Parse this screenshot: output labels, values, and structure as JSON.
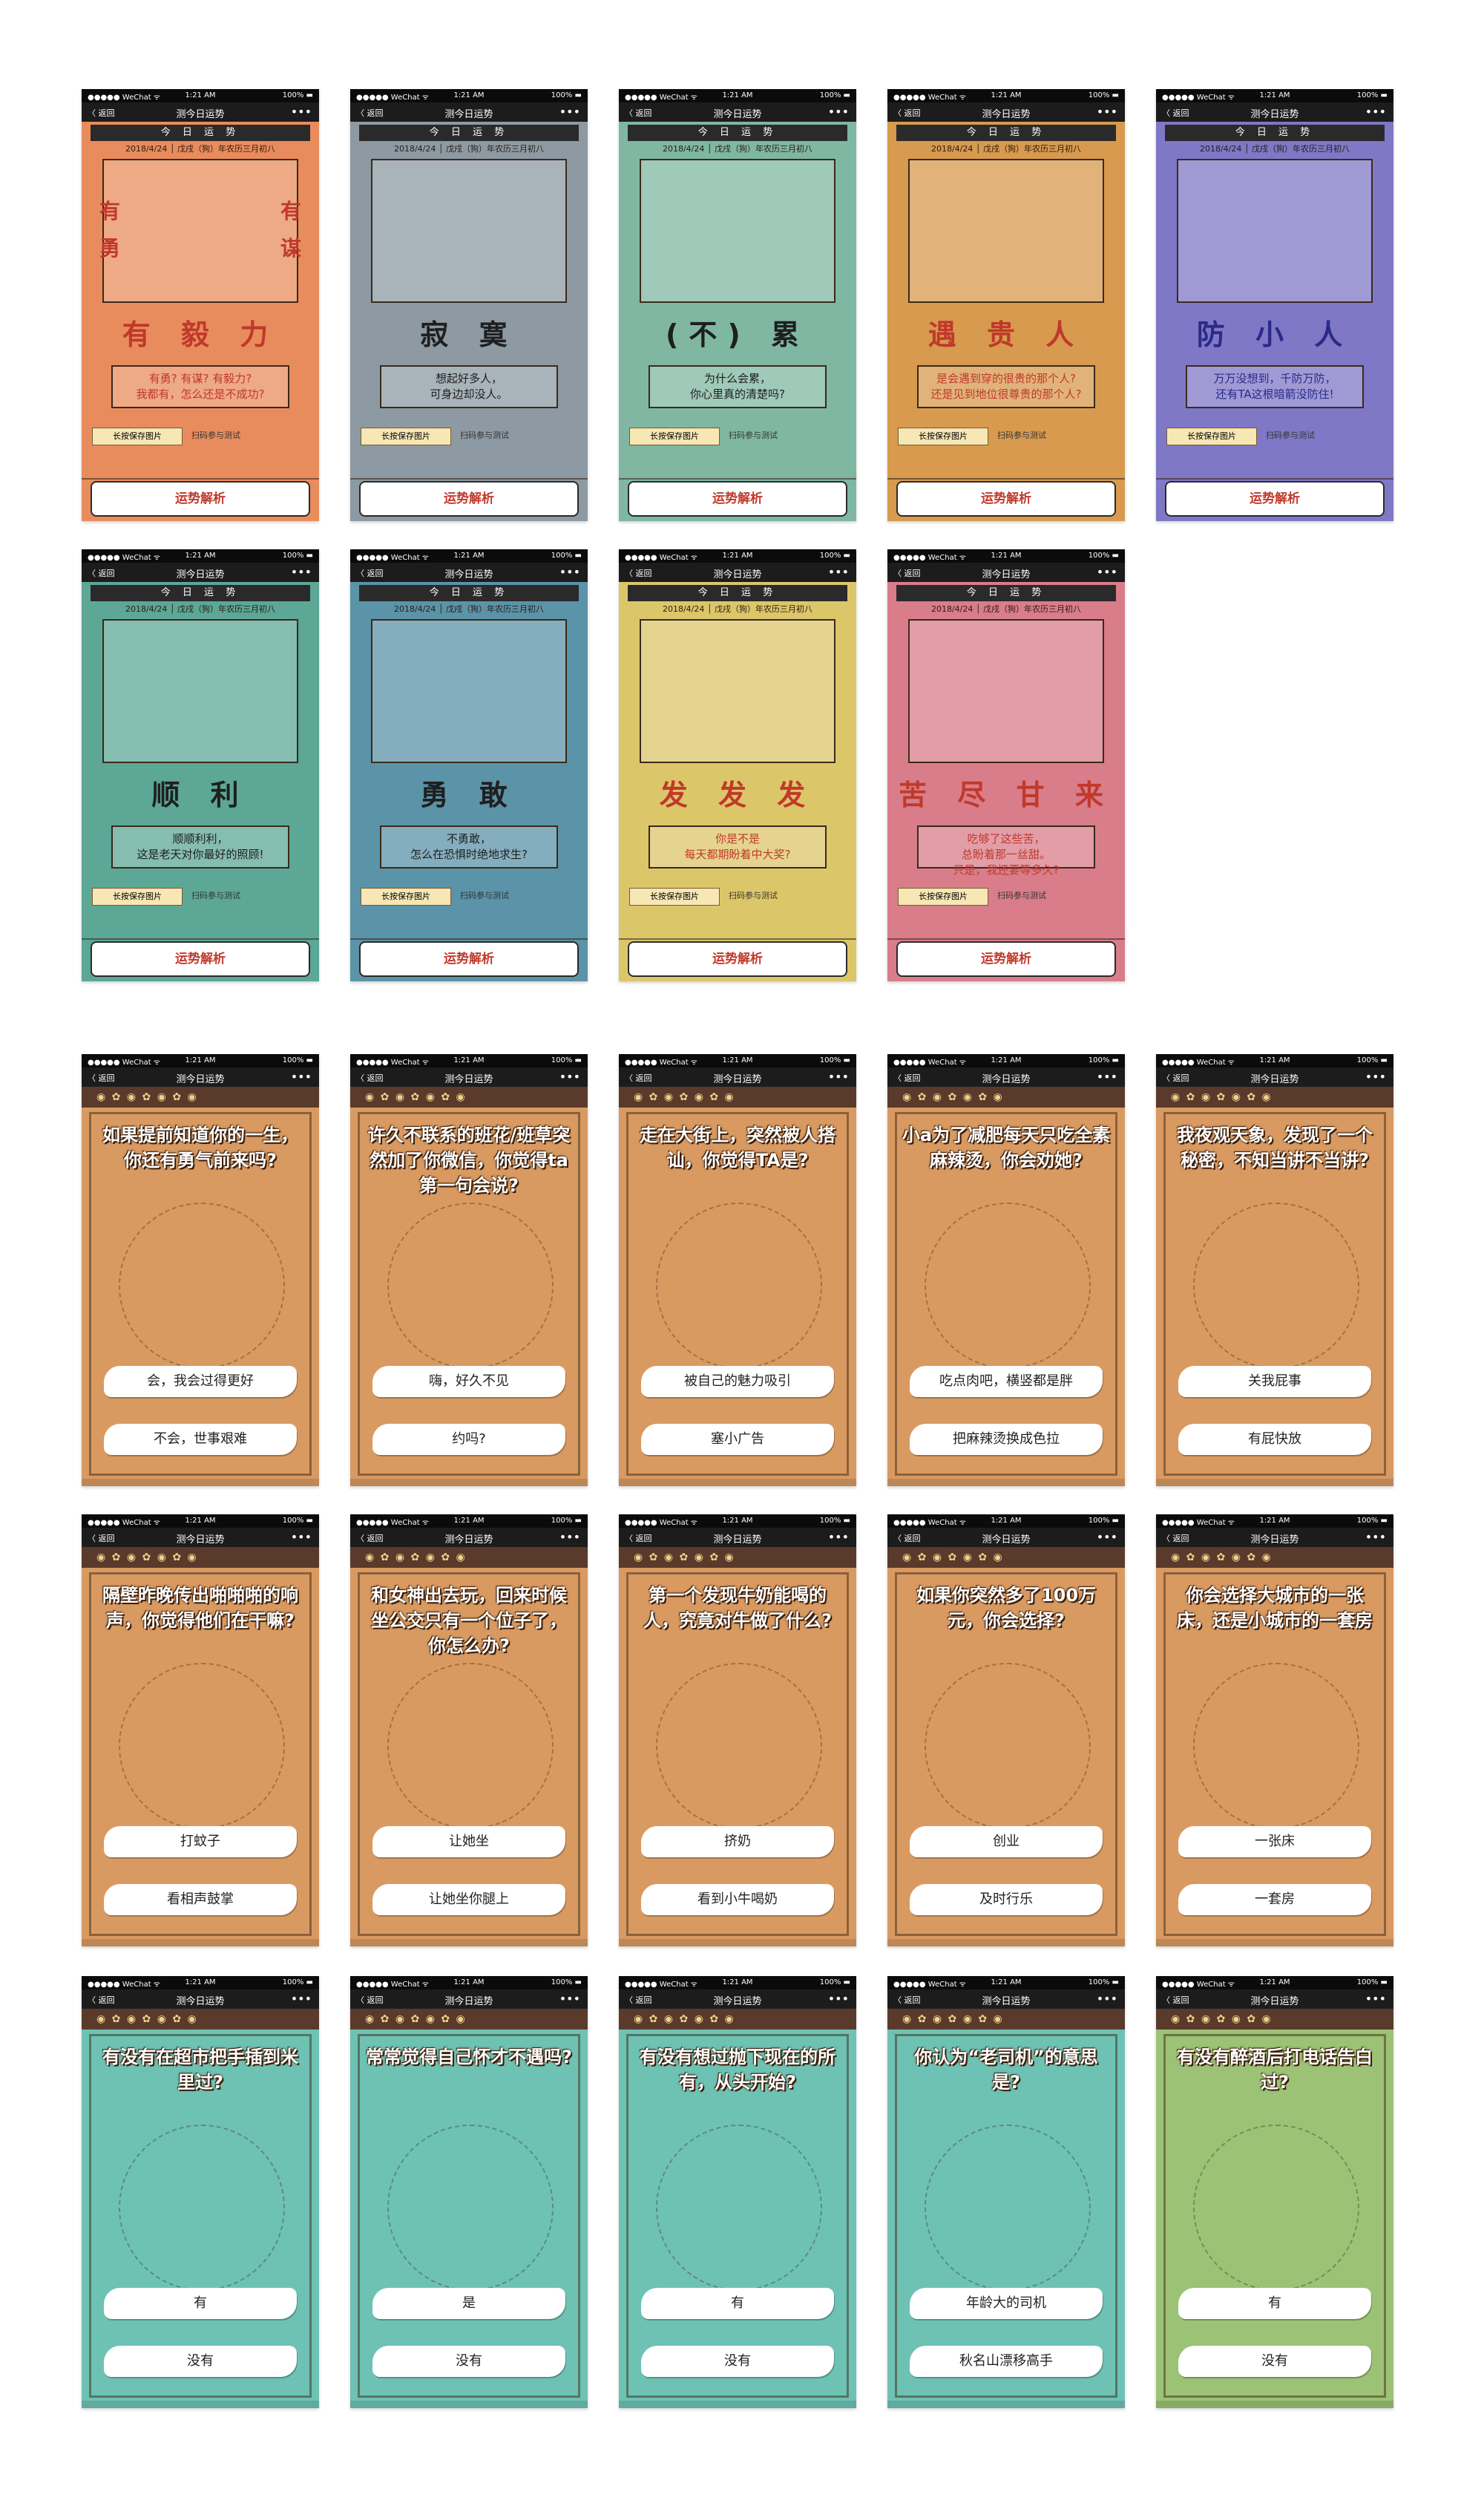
{
  "device": {
    "carrier": "●●●●● WeChat ᯤ",
    "time": "1:21 AM",
    "battery": "100% ▬"
  },
  "nav": {
    "back": "〈 返回",
    "title": "测今日运势",
    "more": "•••"
  },
  "fortune": {
    "header": "今 日 运 势",
    "date": "2018/4/24 │ 戊戌（狗）年农历三月初八",
    "save": "长按保存图片",
    "scan": "扫码参与测试",
    "button": "运势解析",
    "cards": [
      {
        "headline": "有 毅 力",
        "desc": "有勇? 有谋? 有毅力?\n我都有，怎么还是不成功?",
        "side_left": "有 勇",
        "side_right": "有 谋",
        "bg": "#e98c5d",
        "accent": "#c0392b"
      },
      {
        "headline": "寂 寞",
        "desc": "想起好多人，\n可身边却没人。",
        "bg": "#8d9aa3",
        "accent": "#1f1f1f"
      },
      {
        "headline": "(不) 累",
        "desc": "为什么会累，\n你心里真的清楚吗?",
        "bg": "#7fb7a2",
        "accent": "#1f1f1f"
      },
      {
        "headline": "遇 贵 人",
        "desc": "是会遇到穿的很贵的那个人?\n还是见到地位很尊贵的那个人?",
        "bg": "#d79a4e",
        "accent": "#c0392b"
      },
      {
        "headline": "防 小 人",
        "desc": "万万没想到，千防万防，\n还有TA这根暗箭没防住!",
        "bg": "#7f78c6",
        "accent": "#2a2a8a"
      },
      {
        "headline": "顺 利",
        "desc": "顺顺利利，\n这是老天对你最好的照顾!",
        "bg": "#5ca796",
        "accent": "#1f1f1f"
      },
      {
        "headline": "勇 敢",
        "desc": "不勇敢，\n怎么在恐惧时绝地求生?",
        "bg": "#5b93a8",
        "accent": "#1f1f1f"
      },
      {
        "headline": "发 发 发",
        "desc": "你是不是\n每天都期盼着中大奖?",
        "bg": "#dcc66a",
        "accent": "#c0392b"
      },
      {
        "headline": "苦 尽 甘 来",
        "desc": "吃够了这些苦，\n总盼着那一丝甜。\n只是，我还要等多久?",
        "bg": "#d97d8a",
        "accent": "#c0392b"
      }
    ]
  },
  "quiz": {
    "cards": [
      {
        "q": "如果提前知道你的一生，你还有勇气前来吗?",
        "a": "会，我会过得更好",
        "b": "不会，世事艰难",
        "bg": "#d99a62"
      },
      {
        "q": "许久不联系的班花/班草突然加了你微信，你觉得ta第一句会说?",
        "a": "嗨，好久不见",
        "b": "约吗?",
        "bg": "#d99a62"
      },
      {
        "q": "走在大街上，突然被人搭讪，你觉得TA是?",
        "a": "被自己的魅力吸引",
        "b": "塞小广告",
        "bg": "#d99a62"
      },
      {
        "q": "小a为了减肥每天只吃全素麻辣烫，你会劝她?",
        "a": "吃点肉吧，横竖都是胖",
        "b": "把麻辣烫换成色拉",
        "bg": "#d99a62"
      },
      {
        "q": "我夜观天象，发现了一个秘密，不知当讲不当讲?",
        "a": "关我屁事",
        "b": "有屁快放",
        "bg": "#d99a62"
      },
      {
        "q": "隔壁昨晚传出啪啪啪的响声，你觉得他们在干嘛?",
        "a": "打蚊子",
        "b": "看相声鼓掌",
        "bg": "#d99a62"
      },
      {
        "q": "和女神出去玩，回来时候坐公交只有一个位子了，你怎么办?",
        "a": "让她坐",
        "b": "让她坐你腿上",
        "bg": "#d99a62"
      },
      {
        "q": "第一个发现牛奶能喝的人，究竟对牛做了什么?",
        "a": "挤奶",
        "b": "看到小牛喝奶",
        "bg": "#d99a62"
      },
      {
        "q": "如果你突然多了100万元，你会选择?",
        "a": "创业",
        "b": "及时行乐",
        "bg": "#d99a62"
      },
      {
        "q": "你会选择大城市的一张床，还是小城市的一套房",
        "a": "一张床",
        "b": "一套房",
        "bg": "#d99a62"
      },
      {
        "q": "有没有在超市把手插到米里过?",
        "a": "有",
        "b": "没有",
        "bg": "#6ec2b4"
      },
      {
        "q": "常常觉得自己怀才不遇吗?",
        "a": "是",
        "b": "没有",
        "bg": "#6ec2b4"
      },
      {
        "q": "有没有想过抛下现在的所有，从头开始?",
        "a": "有",
        "b": "没有",
        "bg": "#6ec2b4"
      },
      {
        "q": "你认为“老司机”的意思是?",
        "a": "年龄大的司机",
        "b": "秋名山漂移高手",
        "bg": "#6ec2b4"
      },
      {
        "q": "有没有醉酒后打电话告白过?",
        "a": "有",
        "b": "没有",
        "bg": "#9cc276"
      }
    ]
  }
}
